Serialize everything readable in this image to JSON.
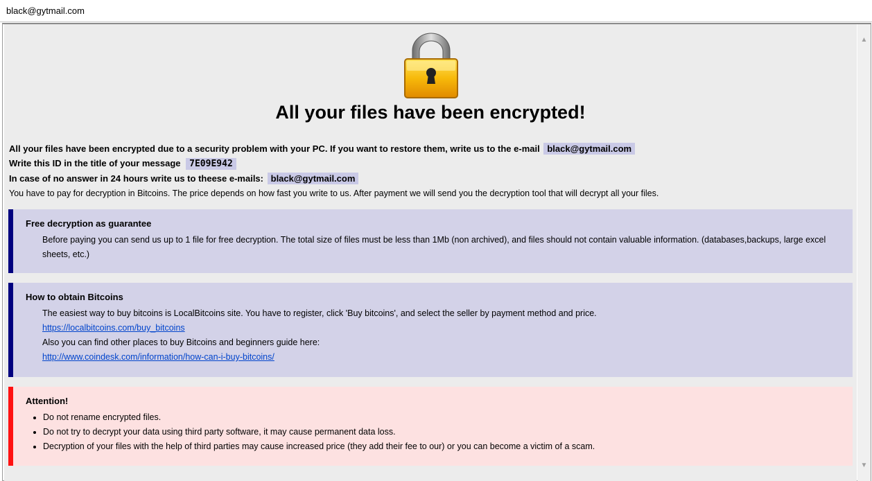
{
  "window": {
    "title": "black@gytmail.com"
  },
  "headline": "All your files have been encrypted!",
  "intro": {
    "line1_text": "All your files have been encrypted due to a security problem with your PC. If you want to restore them, write us to the e-mail",
    "line1_email": "black@gytmail.com",
    "line2_text": "Write this ID in the title of your message",
    "line2_id": "7E09E942",
    "line3_text": "In case of no answer in 24 hours write us to theese e-mails:",
    "line3_email": "black@gytmail.com",
    "line4_text": "You have to pay for decryption in Bitcoins. The price depends on how fast you write to us. After payment we will send you the decryption tool that will decrypt all your files."
  },
  "guarantee": {
    "title": "Free decryption as guarantee",
    "text": "Before paying you can send us up to 1 file for free decryption. The total size of files must be less than 1Mb (non archived), and files should not contain valuable information. (databases,backups, large excel sheets, etc.)"
  },
  "bitcoins": {
    "title": "How to obtain Bitcoins",
    "text1": "The easiest way to buy bitcoins is LocalBitcoins site. You have to register, click 'Buy bitcoins', and select the seller by payment method and price.",
    "link1": "https://localbitcoins.com/buy_bitcoins",
    "text2": "Also you can find other places to buy Bitcoins and beginners guide here:",
    "link2": "http://www.coindesk.com/information/how-can-i-buy-bitcoins/"
  },
  "attention": {
    "title": "Attention!",
    "items": [
      "Do not rename encrypted files.",
      "Do not try to decrypt your data using third party software, it may cause permanent data loss.",
      "Decryption of your files with the help of third parties may cause increased price (they add their fee to our) or you can become a victim of a scam."
    ]
  },
  "icons": {
    "lock": "padlock-icon",
    "scroll_up": "scroll-up-arrow-icon",
    "scroll_down": "scroll-down-arrow-icon"
  },
  "colors": {
    "background": "#ececec",
    "blue_box": "#d3d2e8",
    "blue_accent": "#00007f",
    "red_box": "#fde1e1",
    "red_accent": "#ff1111",
    "highlight": "#c9c9e6",
    "link": "#0044cc"
  }
}
